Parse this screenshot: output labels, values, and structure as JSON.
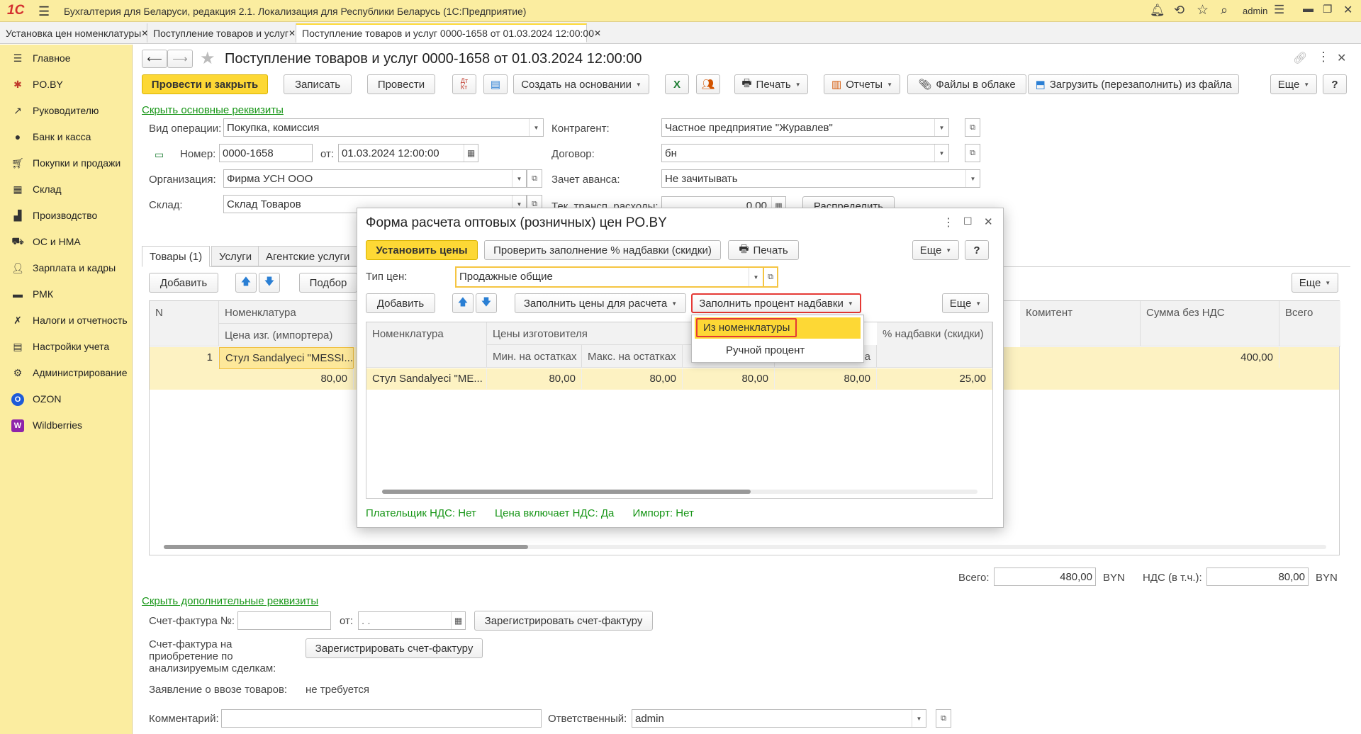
{
  "app": {
    "title": "Бухгалтерия для Беларуси, редакция 2.1. Локализация для Республики Беларусь   (1С:Предприятие)",
    "user": "admin",
    "logo": "1С"
  },
  "open_tabs": [
    {
      "label": "Установка цен номенклатуры"
    },
    {
      "label": "Поступление товаров и услуг"
    },
    {
      "label": "Поступление товаров и услуг 0000-1658 от 01.03.2024 12:00:00"
    }
  ],
  "sidebar": {
    "items": [
      {
        "label": "Главное",
        "icon": "menu-icon"
      },
      {
        "label": "PO.BY",
        "icon": "poby-icon"
      },
      {
        "label": "Руководителю",
        "icon": "chart-icon"
      },
      {
        "label": "Банк и касса",
        "icon": "bank-icon"
      },
      {
        "label": "Покупки и продажи",
        "icon": "cart-icon"
      },
      {
        "label": "Склад",
        "icon": "warehouse-icon"
      },
      {
        "label": "Производство",
        "icon": "production-icon"
      },
      {
        "label": "ОС и НМА",
        "icon": "truck-icon"
      },
      {
        "label": "Зарплата и кадры",
        "icon": "person-icon"
      },
      {
        "label": "РМК",
        "icon": "register-icon"
      },
      {
        "label": "Налоги и отчетность",
        "icon": "taxes-icon"
      },
      {
        "label": "Настройки учета",
        "icon": "book-icon"
      },
      {
        "label": "Администрирование",
        "icon": "gear-icon"
      },
      {
        "label": "OZON",
        "icon": "ozon-icon"
      },
      {
        "label": "Wildberries",
        "icon": "wildberries-icon"
      }
    ]
  },
  "doc": {
    "title": "Поступление товаров и услуг 0000-1658 от 01.03.2024 12:00:00",
    "toolbar": {
      "post_close": "Провести и закрыть",
      "save": "Записать",
      "post": "Провести",
      "create_based": "Создать на основании",
      "print": "Печать",
      "reports": "Отчеты",
      "cloud_files": "Файлы в облаке",
      "load_file": "Загрузить (перезаполнить) из файла",
      "more": "Еще",
      "help": "?"
    },
    "hide_main_link": "Скрыть основные реквизиты",
    "fields": {
      "op_type_label": "Вид операции:",
      "op_type": "Покупка, комиссия",
      "number_label": "Номер:",
      "number": "0000-1658",
      "from_label": "от:",
      "date": "01.03.2024 12:00:00",
      "org_label": "Организация:",
      "org": "Фирма УСН ООО",
      "warehouse_label": "Склад:",
      "warehouse": "Склад Товаров",
      "counterparty_label": "Контрагент:",
      "counterparty": "Частное предприятие \"Журавлев\"",
      "contract_label": "Договор:",
      "contract": "бн",
      "advance_label": "Зачет аванса:",
      "advance": "Не зачитывать",
      "transport_label": "Тек. трансп. расходы:",
      "transport": "0,00",
      "distribute": "Распределить"
    },
    "tabs": [
      "Товары (1)",
      "Услуги",
      "Агентские услуги"
    ],
    "table_toolbar": {
      "add": "Добавить",
      "pick": "Подбор",
      "more": "Еще"
    },
    "table": {
      "headers": {
        "n": "N",
        "nomenclature": "Номенклатура",
        "maker_price": "Цена изг. (импортера)",
        "committent": "Комитент",
        "sum_no_vat": "Сумма без НДС",
        "total": "Всего"
      },
      "rows": [
        {
          "n": "1",
          "nomenclature": "Стул Sandalyeci \"MESSI...",
          "maker_price": "80,00",
          "sum_no_vat": "400,00"
        }
      ]
    },
    "totals": {
      "total_label": "Всего:",
      "total": "480,00",
      "currency": "BYN",
      "vat_label": "НДС (в т.ч.):",
      "vat": "80,00"
    },
    "hide_extra_link": "Скрыть дополнительные реквизиты",
    "invoice": {
      "label": "Счет-фактура №:",
      "from_label": "от:",
      "date_placeholder": " .  .",
      "register": "Зарегистрировать счет-фактуру",
      "purchase_label": "Счет-фактура на приобретение по анализируемым сделкам:",
      "register2": "Зарегистрировать счет-фактуру",
      "import_label": "Заявление о ввозе товаров:",
      "import_value": "не требуется"
    },
    "comment_label": "Комментарий:",
    "responsible_label": "Ответственный:",
    "responsible": "admin"
  },
  "dialog": {
    "title": "Форма расчета оптовых (розничных) цен PO.BY",
    "set_prices": "Установить цены",
    "check_fill": "Проверить заполнение % надбавки (скидки)",
    "print": "Печать",
    "more": "Еще",
    "help": "?",
    "price_type_label": "Тип цен:",
    "price_type": "Продажные общие",
    "add": "Добавить",
    "fill_prices": "Заполнить цены для расчета",
    "fill_percent": "Заполнить процент надбавки",
    "more2": "Еще",
    "table": {
      "headers": {
        "nomenclature": "Номенклатура",
        "maker_prices": "Цены изготовителя",
        "min": "Мин. на остатках",
        "max": "Макс. на остатках",
        "col_a": "а",
        "percent": "% надбавки (скидки)"
      },
      "row": {
        "nomenclature": "Стул Sandalyeci \"ME...",
        "min": "80,00",
        "max": "80,00",
        "c3": "80,00",
        "c4": "80,00",
        "percent": "25,00"
      }
    },
    "footer": {
      "vat_payer_label": "Плательщик НДС:",
      "vat_payer": "Нет",
      "price_incl_label": "Цена включает НДС:",
      "price_incl": "Да",
      "import_label": "Импорт:",
      "import": "Нет"
    },
    "menu": {
      "from_nomenclature": "Из номенклатуры",
      "manual": "Ручной процент"
    }
  },
  "colors": {
    "sidebar_bg": "#fbeda0",
    "accent_yellow": "#fdd835",
    "link_green": "#169516",
    "highlight_red": "#e53935"
  }
}
